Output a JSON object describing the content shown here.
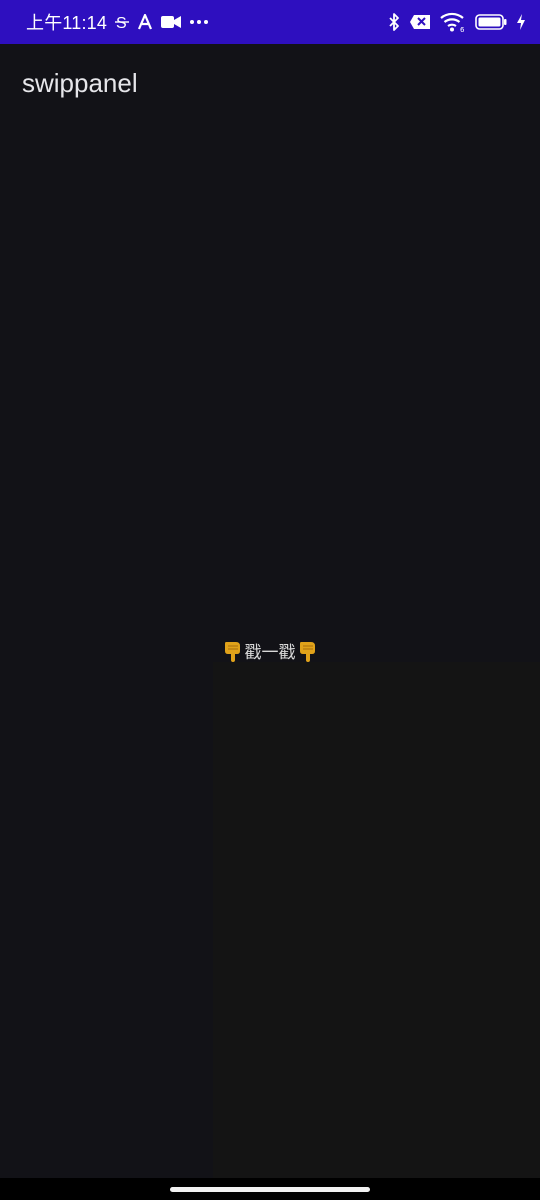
{
  "status_bar": {
    "time": "上午11:14",
    "background": "#2e0fbf",
    "left_icons": [
      "s-sync-icon",
      "a-font-icon",
      "video-camera-icon",
      "more-dots-icon"
    ],
    "right_icons": [
      "bluetooth-icon",
      "sim-off-icon",
      "wifi-icon",
      "battery-icon",
      "charging-bolt-icon"
    ],
    "wifi_label": "6"
  },
  "app": {
    "title": "swippanel",
    "background": "#121217",
    "panel_background": "#141414"
  },
  "hint": {
    "label": "戳一戳",
    "icon": "pointing-down-hand-icon",
    "icon_color": "#e0a21a"
  }
}
